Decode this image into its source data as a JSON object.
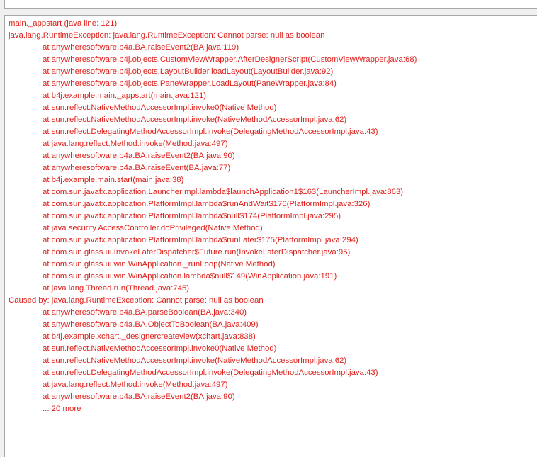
{
  "log": {
    "lines": [
      {
        "text": "main._appstart (java line: 121)",
        "indent": false
      },
      {
        "text": "java.lang.RuntimeException: java.lang.RuntimeException: Cannot parse: null as boolean",
        "indent": false
      },
      {
        "text": "at anywheresoftware.b4a.BA.raiseEvent2(BA.java:119)",
        "indent": true
      },
      {
        "text": "at anywheresoftware.b4j.objects.CustomViewWrapper.AfterDesignerScript(CustomViewWrapper.java:68)",
        "indent": true
      },
      {
        "text": "at anywheresoftware.b4j.objects.LayoutBuilder.loadLayout(LayoutBuilder.java:92)",
        "indent": true
      },
      {
        "text": "at anywheresoftware.b4j.objects.PaneWrapper.LoadLayout(PaneWrapper.java:84)",
        "indent": true
      },
      {
        "text": "at b4j.example.main._appstart(main.java:121)",
        "indent": true
      },
      {
        "text": "at sun.reflect.NativeMethodAccessorImpl.invoke0(Native Method)",
        "indent": true
      },
      {
        "text": "at sun.reflect.NativeMethodAccessorImpl.invoke(NativeMethodAccessorImpl.java:62)",
        "indent": true
      },
      {
        "text": "at sun.reflect.DelegatingMethodAccessorImpl.invoke(DelegatingMethodAccessorImpl.java:43)",
        "indent": true
      },
      {
        "text": "at java.lang.reflect.Method.invoke(Method.java:497)",
        "indent": true
      },
      {
        "text": "at anywheresoftware.b4a.BA.raiseEvent2(BA.java:90)",
        "indent": true
      },
      {
        "text": "at anywheresoftware.b4a.BA.raiseEvent(BA.java:77)",
        "indent": true
      },
      {
        "text": "at b4j.example.main.start(main.java:38)",
        "indent": true
      },
      {
        "text": "at com.sun.javafx.application.LauncherImpl.lambda$launchApplication1$163(LauncherImpl.java:863)",
        "indent": true
      },
      {
        "text": "at com.sun.javafx.application.PlatformImpl.lambda$runAndWait$176(PlatformImpl.java:326)",
        "indent": true
      },
      {
        "text": "at com.sun.javafx.application.PlatformImpl.lambda$null$174(PlatformImpl.java:295)",
        "indent": true
      },
      {
        "text": "at java.security.AccessController.doPrivileged(Native Method)",
        "indent": true
      },
      {
        "text": "at com.sun.javafx.application.PlatformImpl.lambda$runLater$175(PlatformImpl.java:294)",
        "indent": true
      },
      {
        "text": "at com.sun.glass.ui.InvokeLaterDispatcher$Future.run(InvokeLaterDispatcher.java:95)",
        "indent": true
      },
      {
        "text": "at com.sun.glass.ui.win.WinApplication._runLoop(Native Method)",
        "indent": true
      },
      {
        "text": "at com.sun.glass.ui.win.WinApplication.lambda$null$149(WinApplication.java:191)",
        "indent": true
      },
      {
        "text": "at java.lang.Thread.run(Thread.java:745)",
        "indent": true
      },
      {
        "text": "Caused by: java.lang.RuntimeException: Cannot parse: null as boolean",
        "indent": false
      },
      {
        "text": "at anywheresoftware.b4a.BA.parseBoolean(BA.java:340)",
        "indent": true
      },
      {
        "text": "at anywheresoftware.b4a.BA.ObjectToBoolean(BA.java:409)",
        "indent": true
      },
      {
        "text": "at b4j.example.xchart._designercreateview(xchart.java:838)",
        "indent": true
      },
      {
        "text": "at sun.reflect.NativeMethodAccessorImpl.invoke0(Native Method)",
        "indent": true
      },
      {
        "text": "at sun.reflect.NativeMethodAccessorImpl.invoke(NativeMethodAccessorImpl.java:62)",
        "indent": true
      },
      {
        "text": "at sun.reflect.DelegatingMethodAccessorImpl.invoke(DelegatingMethodAccessorImpl.java:43)",
        "indent": true
      },
      {
        "text": "at java.lang.reflect.Method.invoke(Method.java:497)",
        "indent": true
      },
      {
        "text": "at anywheresoftware.b4a.BA.raiseEvent2(BA.java:90)",
        "indent": true
      },
      {
        "text": "... 20 more",
        "indent": true
      }
    ]
  },
  "colors": {
    "error_text": "#e0201b",
    "panel_background": "#ffffff",
    "window_background": "#f0f0f0"
  }
}
